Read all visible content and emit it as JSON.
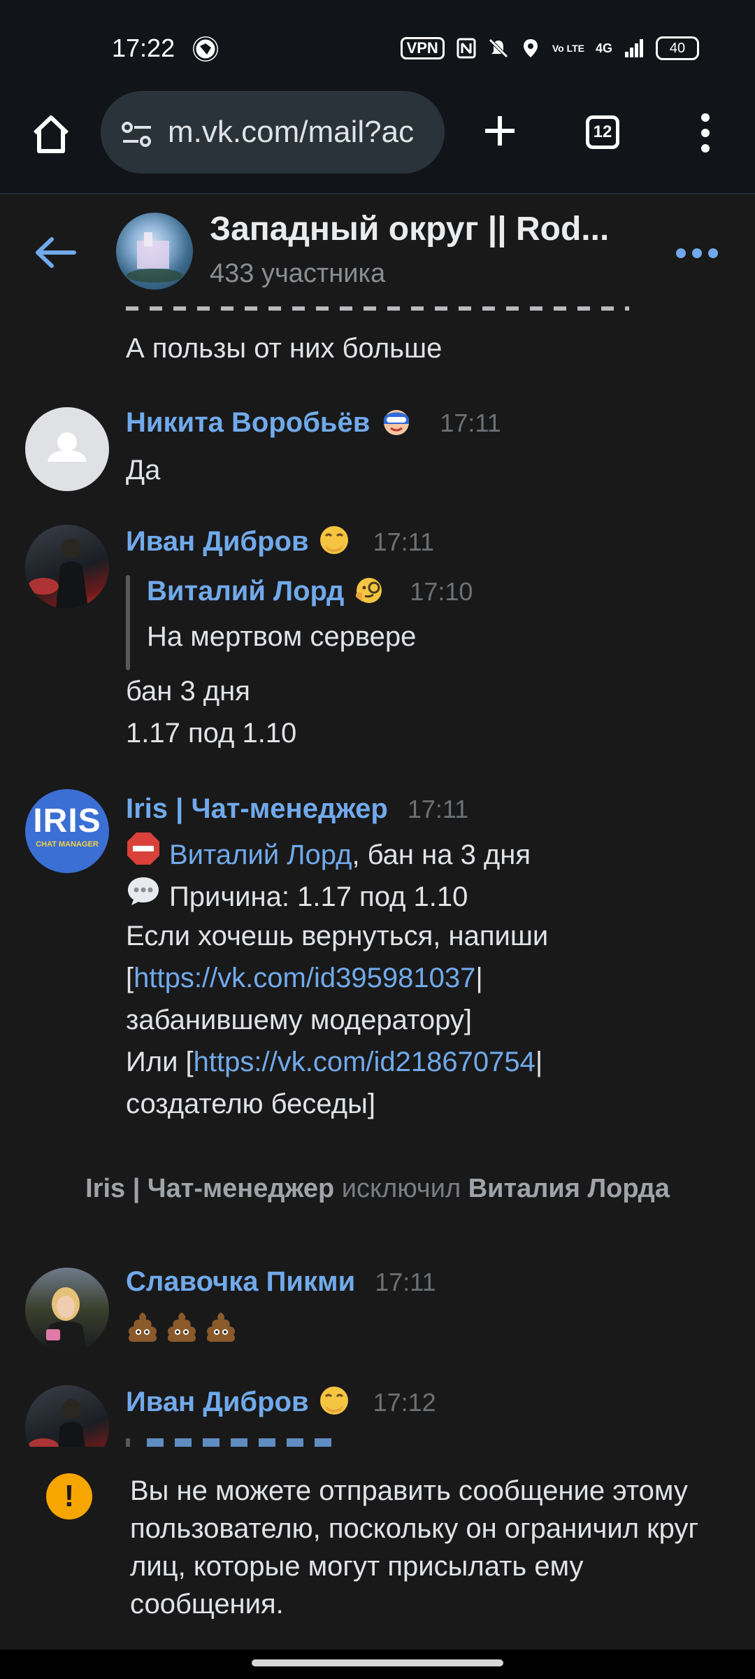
{
  "status_bar": {
    "time": "17:22",
    "vpn_label": "VPN",
    "volte_label": "Vo LTE",
    "network_label": "4G",
    "battery_level": "40"
  },
  "browser": {
    "url": "m.vk.com/mail?ac",
    "tab_count": "12"
  },
  "chat": {
    "title": "Западный округ || Rod...",
    "members": "433 участника"
  },
  "messages": {
    "partial_text": "А пользы от них больше",
    "m1": {
      "name": "Никита Воробьёв",
      "time": "17:11",
      "text": "Да"
    },
    "m2": {
      "name": "Иван Дибров",
      "time": "17:11",
      "quote_name": "Виталий Лорд",
      "quote_time": "17:10",
      "quote_text": "На мертвом сервере",
      "line1": "бан 3 дня",
      "line2": "1.17 под 1.10"
    },
    "m3": {
      "name": "Iris | Чат-менеджер",
      "time": "17:11",
      "avatar_text": "IRIS",
      "avatar_sub": "CHAT MANAGER",
      "ban_user": "Виталий Лорд",
      "ban_rest": ", бан на 3 дня",
      "reason": "Причина: 1.17 под 1.10",
      "return_text": "Если хочешь вернуться, напиши",
      "bracket_open": "[",
      "link1": "https://vk.com/id395981037",
      "link1_suffix": "|",
      "mod_text": "забанившему модератору]",
      "or_text": "Или [",
      "link2": "https://vk.com/id218670754",
      "link2_suffix": "|",
      "creator_text": "создателю беседы]"
    },
    "system": {
      "actor": "Iris | Чат-менеджер",
      "action": " исключил ",
      "target": "Виталия Лорда"
    },
    "m4": {
      "name": "Славочка Пикми",
      "time": "17:11"
    },
    "m5": {
      "name": "Иван Дибров",
      "time": "17:12"
    }
  },
  "notice": {
    "icon": "!",
    "text": "Вы не можете отправить сообщение этому пользователю, поскольку он ограничил круг лиц, которые могут присылать ему сообщения."
  },
  "colors": {
    "background": "#19191a",
    "name_blue": "#71aaeb",
    "warning": "#f7a600"
  }
}
